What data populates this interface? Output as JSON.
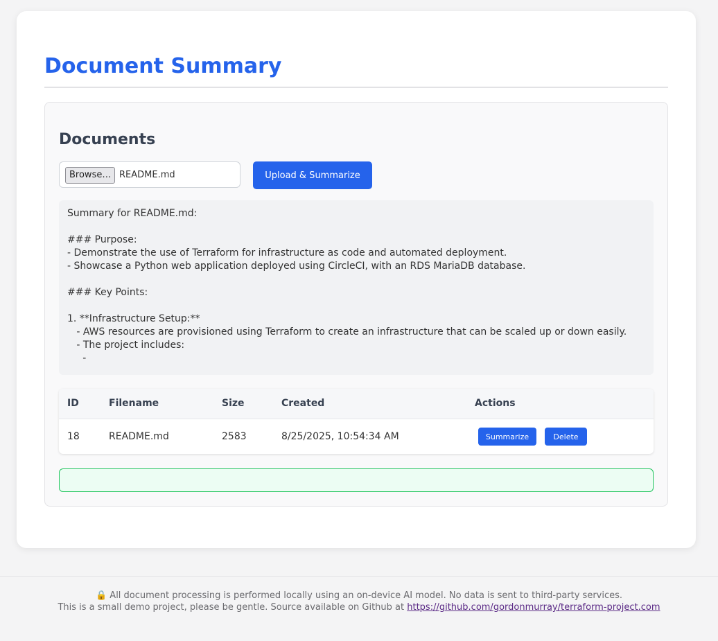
{
  "page": {
    "title": "Document Summary"
  },
  "documents": {
    "heading": "Documents",
    "browse_label": "Browse…",
    "selected_file": "README.md",
    "upload_label": "Upload & Summarize"
  },
  "summary": {
    "text": "Summary for README.md:\n\n### Purpose:\n- Demonstrate the use of Terraform for infrastructure as code and automated deployment.\n- Showcase a Python web application deployed using CircleCI, with an RDS MariaDB database.\n\n### Key Points:\n\n1. **Infrastructure Setup:**\n   - AWS resources are provisioned using Terraform to create an infrastructure that can be scaled up or down easily.\n   - The project includes:\n     -"
  },
  "table": {
    "headers": {
      "id": "ID",
      "filename": "Filename",
      "size": "Size",
      "created": "Created",
      "actions": "Actions"
    },
    "rows": [
      {
        "id": "18",
        "filename": "README.md",
        "size": "2583",
        "created": "8/25/2025, 10:54:34 AM",
        "summarize_label": "Summarize",
        "delete_label": "Delete"
      }
    ]
  },
  "status": {
    "message": ""
  },
  "footer": {
    "privacy_icon": "lock-icon",
    "privacy_glyph": "🔒",
    "privacy_text": "All document processing is performed locally using an on-device AI model. No data is sent to third-party services.",
    "source_text": "This is a small demo project, please be gentle. Source available on Github at ",
    "source_link": "https://github.com/gordonmurray/terraform-project.com"
  },
  "colors": {
    "accent": "#2563eb",
    "status_border": "#22c55e",
    "status_background": "#ecfdf3"
  }
}
